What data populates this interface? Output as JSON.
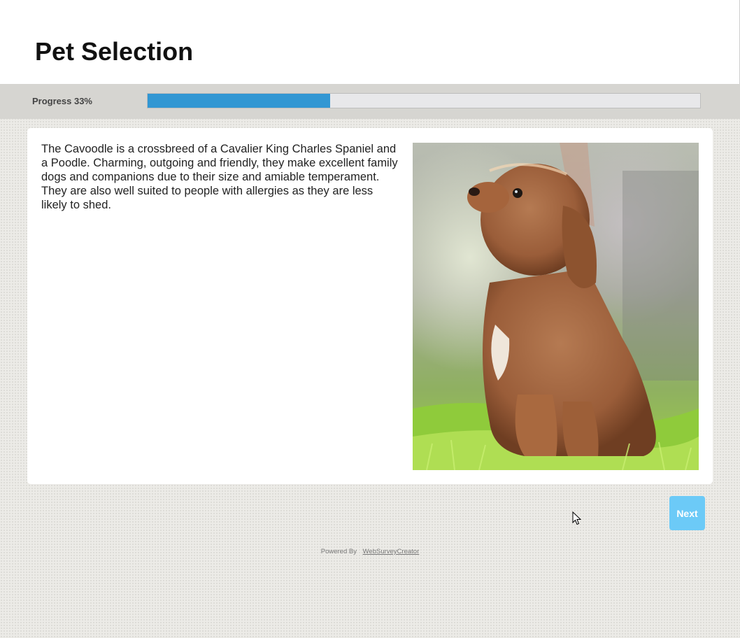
{
  "header": {
    "title": "Pet Selection"
  },
  "progress": {
    "label": "Progress 33%",
    "percent": 33,
    "fill_color": "#3297d3"
  },
  "content": {
    "description": "The Cavoodle is a crossbreed of a Cavalier King Charles Spaniel and a Poodle. Charming, outgoing and friendly, they make excellent family dogs and companions due to their size and amiable temperament. They are also well suited to people with allergies as they are less likely to shed.",
    "image_icon": "cavoodle-puppy-photo"
  },
  "navigation": {
    "next_label": "Next",
    "button_color": "#6ccaf7"
  },
  "footer": {
    "prefix": "Powered By",
    "link_text": "WebSurveyCreator"
  }
}
